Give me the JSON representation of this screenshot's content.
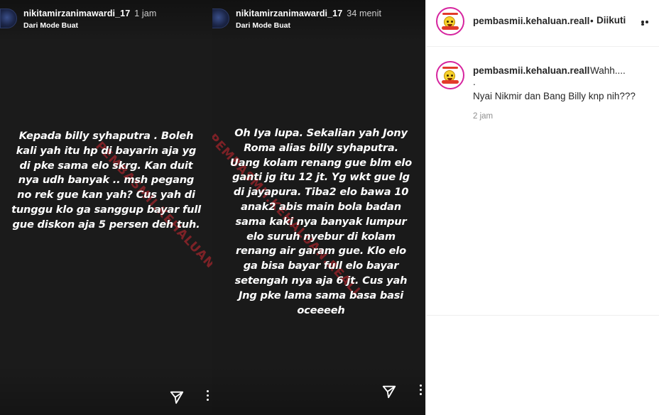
{
  "stories": [
    {
      "username": "nikitamirzanimawardi_17",
      "time": "1 jam",
      "subtitle": "Dari Mode Buat",
      "lines": [
        "Kepada billy syhaputra . Boleh",
        "kali yah itu hp di bayarin aja yg",
        "di pke sama elo skrg. Kan duit",
        "nya udh banyak .. msh pegang",
        "no rek gue kan yah? Cus yah di",
        "tunggu klo ga sanggup bayar full",
        "gue diskon aja 5 persen deh tuh."
      ],
      "watermark": "PEMBASMII.KEHALUAN"
    },
    {
      "username": "nikitamirzanimawardi_17",
      "time": "34 menit",
      "subtitle": "Dari Mode Buat",
      "lines": [
        "Oh Iya lupa. Sekalian yah Jony",
        "Roma alias billy syhaputra.",
        "Uang kolam renang gue blm elo",
        "ganti jg itu 12 jt. Yg wkt gue lg",
        "di jayapura. Tiba2 elo bawa 10",
        "anak2 abis main bola badan",
        "sama kaki nya banyak lumpur",
        "elo suruh nyebur di kolam",
        "renang air garam gue. Klo elo",
        "ga bisa bayar full elo bayar",
        "setengah nya aja 6 jt. Cus yah",
        "Jng pke lama sama basa basi",
        "oceeeeh"
      ],
      "watermark": "PEMBASMII.KEHALUAN.REALL"
    }
  ],
  "post": {
    "username": "pembasmii.kehaluan.reall",
    "separator": "•",
    "follow_label": "Diikuti",
    "more_icon": "more-horizontal-icon"
  },
  "caption": {
    "username": "pembasmii.kehaluan.reall",
    "text_line1": "Wahh....",
    "text_dot": ".",
    "text_line2": "Nyai Nikmir dan Bang Billy knp nih???",
    "time": "2 jam"
  },
  "icons": {
    "send": "send-icon",
    "story_more": "more-vertical-icon"
  }
}
